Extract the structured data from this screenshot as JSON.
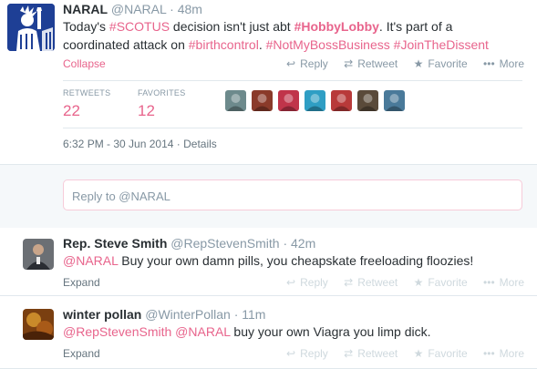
{
  "main_tweet": {
    "name": "NARAL",
    "handle": "@NARAL",
    "time": "48m",
    "text_parts": [
      {
        "t": "Today's ",
        "link": false
      },
      {
        "t": "#SCOTUS",
        "link": true
      },
      {
        "t": " decision isn't just abt ",
        "link": false
      },
      {
        "t": "#HobbyLobby",
        "link": true,
        "bold": true
      },
      {
        "t": ". It's part of a coordinated attack on ",
        "link": false
      },
      {
        "t": "#birthcontrol",
        "link": true
      },
      {
        "t": ". ",
        "link": false
      },
      {
        "t": "#NotMyBossBusiness",
        "link": true
      },
      {
        "t": " ",
        "link": false
      },
      {
        "t": "#JoinTheDissent",
        "link": true
      }
    ],
    "collapse_label": "Collapse",
    "actions": {
      "reply": "Reply",
      "retweet": "Retweet",
      "favorite": "Favorite",
      "more": "More"
    },
    "stats": {
      "retweets_label": "RETWEETS",
      "retweets": "22",
      "favorites_label": "FAVORITES",
      "favorites": "12"
    },
    "favoriter_avatars": [
      "#6d8a8c",
      "#8a3a2a",
      "#c0344a",
      "#2f9ec4",
      "#b83a3a",
      "#5a4a3a",
      "#4a7a9a"
    ],
    "timestamp": "6:32 PM - 30 Jun 2014",
    "details_label": "Details"
  },
  "reply_box": {
    "placeholder": "Reply to @NARAL"
  },
  "replies": [
    {
      "name": "Rep. Steve Smith",
      "handle": "@RepStevenSmith",
      "time": "42m",
      "text_parts": [
        {
          "t": "@NARAL",
          "link": true
        },
        {
          "t": " Buy your own damn pills, you cheapskate freeloading floozies!",
          "link": false
        }
      ],
      "expand_label": "Expand",
      "avatar_color": "#5a5f66"
    },
    {
      "name": "winter pollan",
      "handle": "@WinterPollan",
      "time": "11m",
      "text_parts": [
        {
          "t": "@RepStevenSmith",
          "link": true
        },
        {
          "t": " ",
          "link": false
        },
        {
          "t": "@NARAL",
          "link": true
        },
        {
          "t": " buy your own Viagra you limp dick.",
          "link": false
        }
      ],
      "expand_label": "Expand",
      "avatar_color": "#9a5a1a"
    }
  ],
  "colors": {
    "accent": "#e8648c",
    "muted": "#8899a6",
    "text": "#292f33",
    "naral_blue": "#1e3f95"
  }
}
